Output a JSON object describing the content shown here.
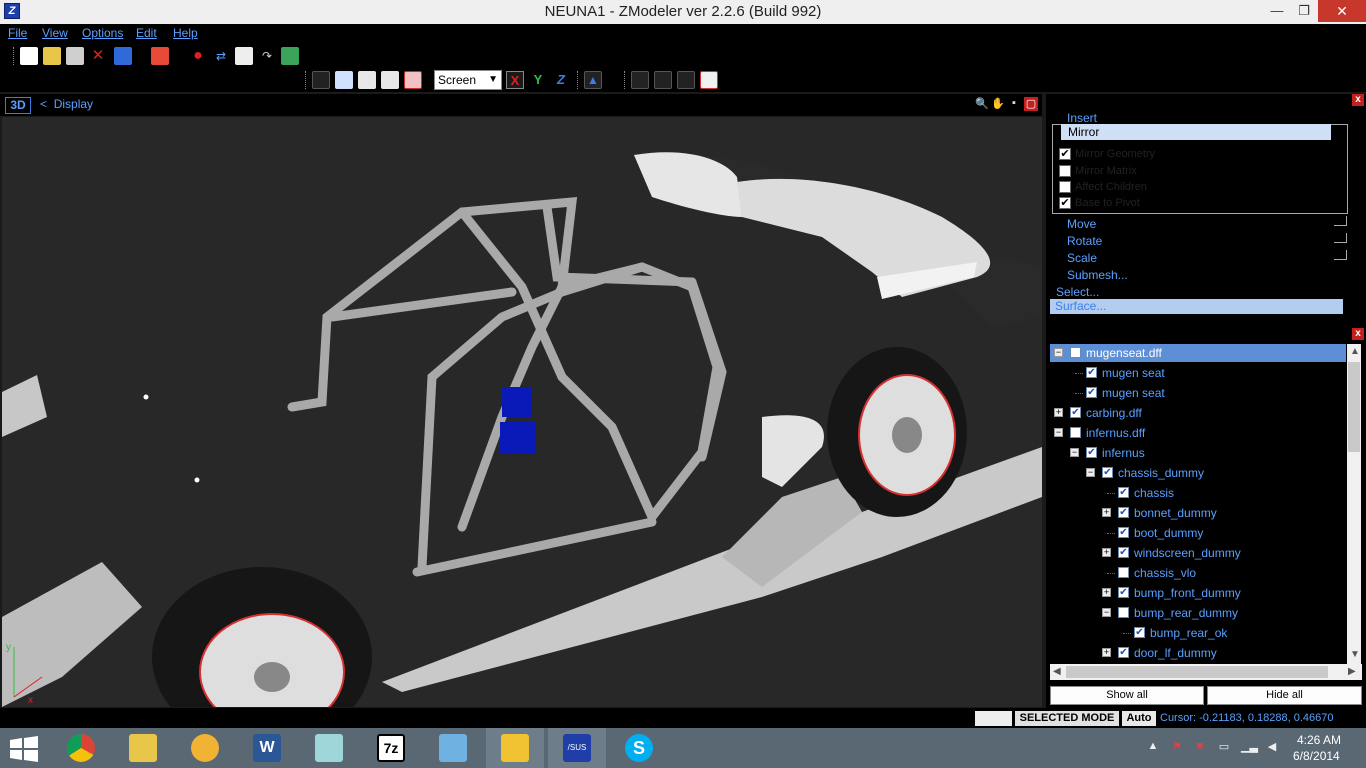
{
  "window": {
    "title": "NEUNA1 - ZModeler ver 2.2.6 (Build 992)",
    "icon_text": "Z",
    "controls": {
      "minimize": "—",
      "maximize": "❐",
      "close": "✕"
    }
  },
  "menu": [
    "File",
    "View",
    "Options",
    "Edit",
    "Help"
  ],
  "toolbar": {
    "screen_select": "Screen",
    "axis_x": "X",
    "axis_y": "Y",
    "axis_z": "Z"
  },
  "viewport": {
    "mode_label": "3D",
    "display_arrow": "<",
    "display_label": "Display",
    "gizmo": {
      "x": "x",
      "y": "y"
    }
  },
  "command_panel": {
    "close": "x",
    "insert": "Insert",
    "mirror": {
      "title": "Mirror",
      "options": [
        {
          "label": "Mirror Geometry",
          "checked": true,
          "mark": "✔"
        },
        {
          "label": "Mirror Matrix",
          "checked": false,
          "mark": ""
        },
        {
          "label": "Affect Children",
          "checked": false,
          "mark": ""
        },
        {
          "label": "Base to Pivot",
          "checked": true,
          "mark": "✔"
        }
      ]
    },
    "move": "Move",
    "rotate": "Rotate",
    "scale": "Scale",
    "submesh": "Submesh...",
    "select": "Select...",
    "surface": "Surface..."
  },
  "tree": {
    "close": "x",
    "rows": [
      {
        "label": "mugenseat.dff",
        "expander": "−",
        "check": "",
        "selected": true
      },
      {
        "label": "mugen seat",
        "expander": "",
        "check": "✔"
      },
      {
        "label": "mugen seat",
        "expander": "",
        "check": "✔"
      },
      {
        "label": "carbing.dff",
        "expander": "+",
        "check": "✔"
      },
      {
        "label": "infernus.dff",
        "expander": "−",
        "check": ""
      },
      {
        "label": "infernus",
        "expander": "−",
        "check": "✔"
      },
      {
        "label": "chassis_dummy",
        "expander": "−",
        "check": "✔"
      },
      {
        "label": "chassis",
        "expander": "",
        "check": "✔"
      },
      {
        "label": "bonnet_dummy",
        "expander": "+",
        "check": "✔"
      },
      {
        "label": "boot_dummy",
        "expander": "",
        "check": "✔"
      },
      {
        "label": "windscreen_dummy",
        "expander": "+",
        "check": "✔"
      },
      {
        "label": "chassis_vlo",
        "expander": "",
        "check": ""
      },
      {
        "label": "bump_front_dummy",
        "expander": "+",
        "check": "✔"
      },
      {
        "label": "bump_rear_dummy",
        "expander": "−",
        "check": ""
      },
      {
        "label": "bump_rear_ok",
        "expander": "",
        "check": "✔"
      },
      {
        "label": "door_lf_dummy",
        "expander": "+",
        "check": "✔"
      }
    ],
    "show_all": "Show all",
    "hide_all": "Hide all"
  },
  "status": {
    "mode": "SELECTED MODE",
    "auto": "Auto",
    "cursor": "Cursor: -0.21183, 0.18288, 0.46670"
  },
  "taskbar": {
    "apps": [
      "chrome-icon",
      "file-explorer-icon",
      "outlook-icon",
      "word-icon",
      "notepad-icon",
      "7zip-icon",
      "photos-icon",
      "paint-icon",
      "asus-icon",
      "skype-icon"
    ],
    "word_letter": "W",
    "sevenzip_text": "7z",
    "asus_text": "/SUS",
    "skype_letter": "S",
    "time": "4:26 AM",
    "date": "6/8/2014"
  }
}
